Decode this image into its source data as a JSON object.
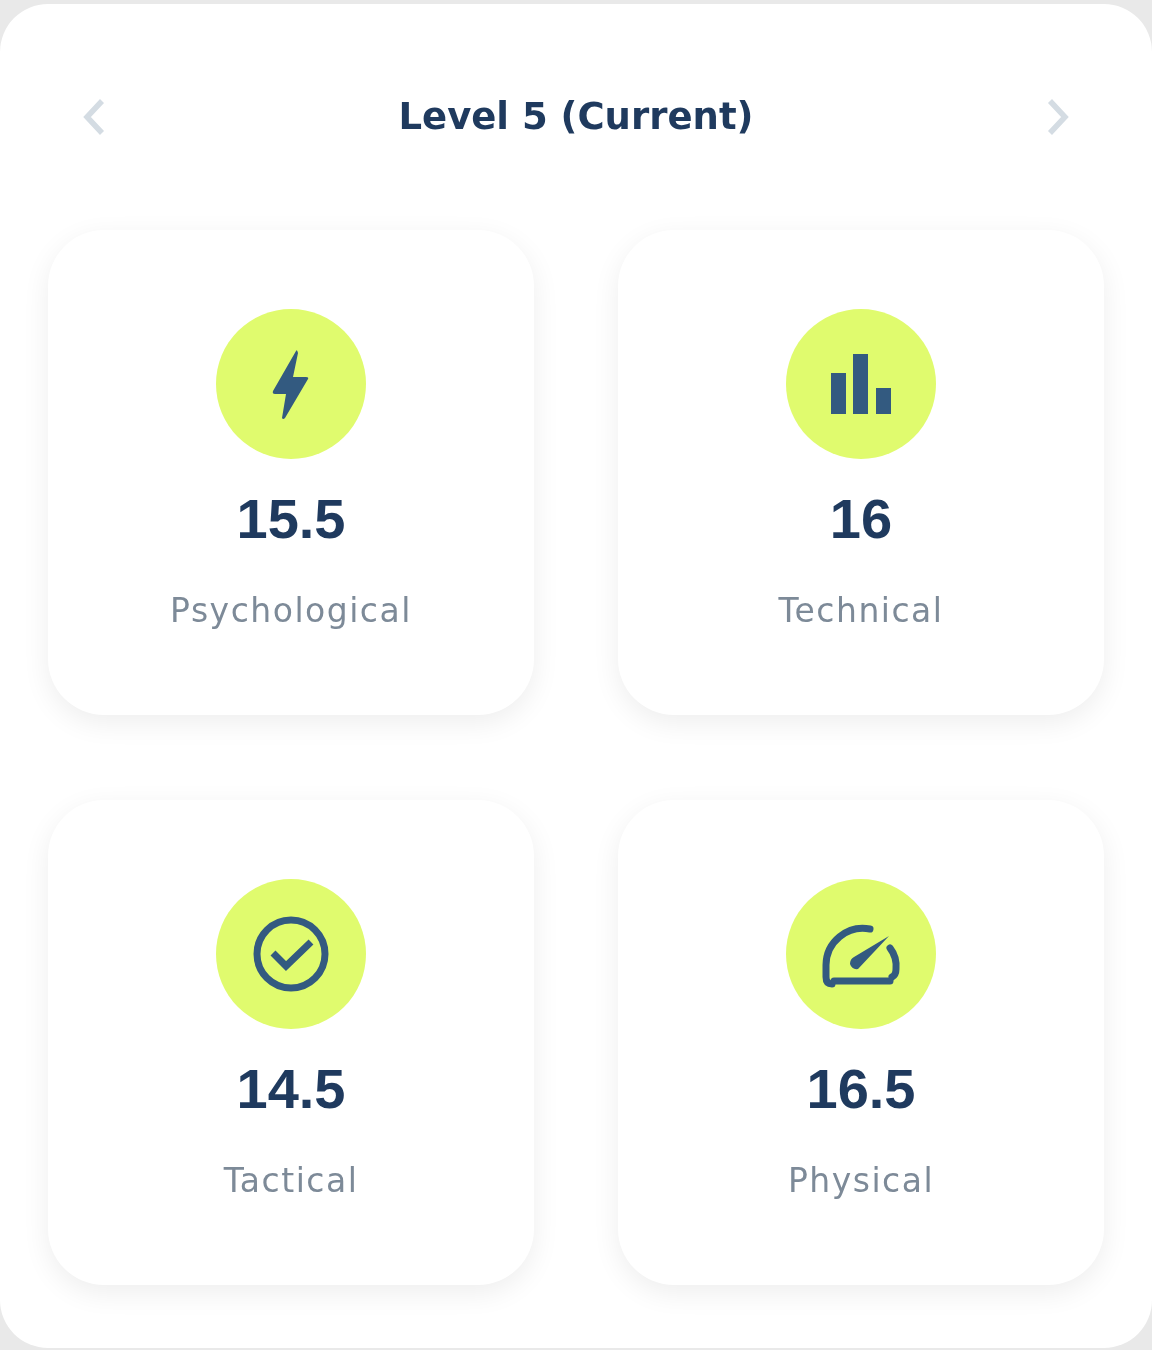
{
  "header": {
    "title": "Level 5 (Current)"
  },
  "stats": [
    {
      "kind": "bolt",
      "value": "15.5",
      "label": "Psychological"
    },
    {
      "kind": "bars",
      "value": "16",
      "label": "Technical"
    },
    {
      "kind": "check",
      "value": "14.5",
      "label": "Tactical"
    },
    {
      "kind": "gauge",
      "value": "16.5",
      "label": "Physical"
    }
  ]
}
